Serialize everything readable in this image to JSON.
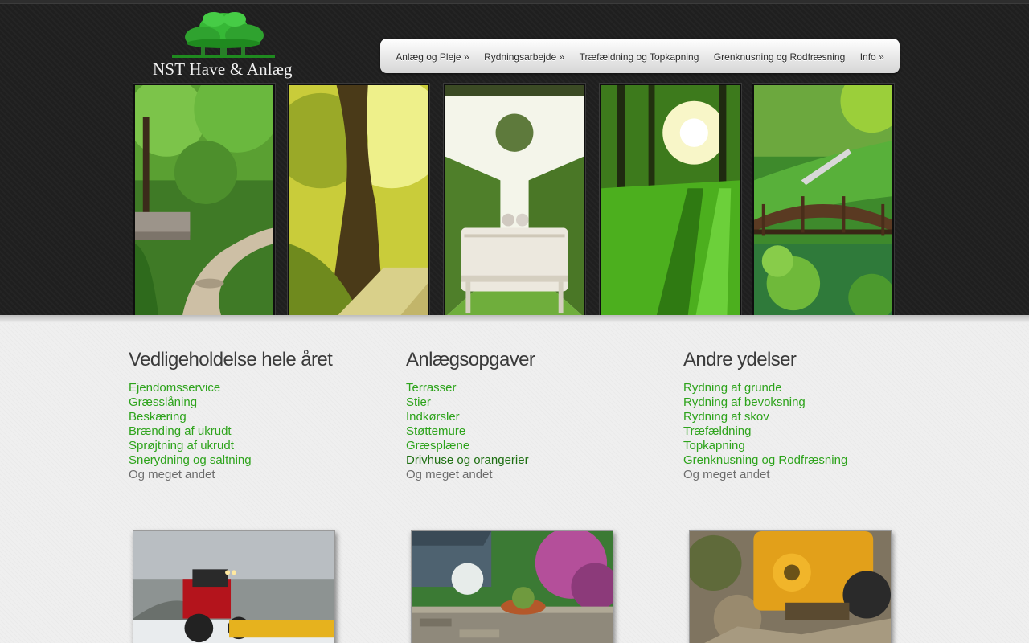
{
  "brand": {
    "logo_text": "NST Have & Anlæg",
    "logo_icon": "tree-icon",
    "colors": {
      "header_bg": "#1f1f1f",
      "link_green": "#2da31b",
      "link_visited": "#1e6f12"
    }
  },
  "nav": {
    "items": [
      {
        "label": "Anlæg og Pleje »"
      },
      {
        "label": "Rydningsarbejde »"
      },
      {
        "label": "Træfældning og Topkapning"
      },
      {
        "label": "Grenknusning og Rodfræsning"
      },
      {
        "label": "Info »"
      }
    ]
  },
  "columns": [
    {
      "title": "Vedligeholdelse hele året",
      "links": [
        "Ejendomsservice",
        "Græsslåning",
        "Beskæring",
        "Brænding af ukrudt",
        "Sprøjtning af ukrudt",
        "Snerydning og saltning"
      ],
      "more": "Og meget andet"
    },
    {
      "title": "Anlægsopgaver",
      "links": [
        "Terrasser",
        "Stier",
        "Indkørsler",
        "Støttemure",
        "Græsplæne",
        "Drivhuse og orangerier"
      ],
      "more": "Og meget andet"
    },
    {
      "title": "Andre ydelser",
      "links": [
        "Rydning af grunde",
        "Rydning af bevoksning",
        "Rydning af skov",
        "Træfældning",
        "Topkapning",
        "Grenknusning og Rodfræsning"
      ],
      "more": "Og meget andet"
    }
  ]
}
